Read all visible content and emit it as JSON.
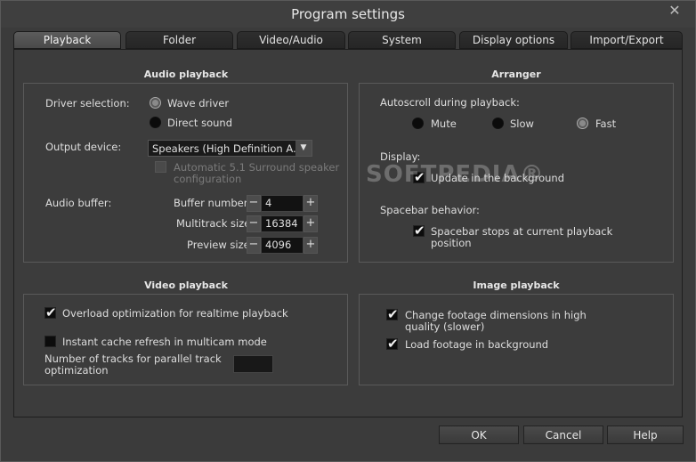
{
  "window": {
    "title": "Program settings",
    "close": "✕"
  },
  "tabs": [
    "Playback",
    "Folder",
    "Video/Audio",
    "System",
    "Display options",
    "Import/Export"
  ],
  "audio": {
    "title": "Audio playback",
    "driver_label": "Driver selection:",
    "driver_options": [
      "Wave driver",
      "Direct sound"
    ],
    "output_label": "Output device:",
    "output_value": "Speakers (High Definition A...",
    "surround_line1": "Automatic 5.1 Surround speaker",
    "surround_line2": "configuration",
    "buffer_label": "Audio buffer:",
    "buffer_number_label": "Buffer number:",
    "buffer_number": "4",
    "multitrack_label": "Multitrack size:",
    "multitrack": "16384",
    "preview_label": "Preview size:",
    "preview": "4096",
    "minus": "−",
    "plus": "+"
  },
  "arranger": {
    "title": "Arranger",
    "autoscroll_label": "Autoscroll during playback:",
    "autoscroll_options": [
      "Mute",
      "Slow",
      "Fast"
    ],
    "display_label": "Display:",
    "update_bg": "Update in the background",
    "spacebar_label": "Spacebar behavior:",
    "spacebar_line1": "Spacebar stops at current playback",
    "spacebar_line2": "position"
  },
  "video": {
    "title": "Video playback",
    "overload": "Overload optimization for realtime playback",
    "cache": "Instant cache refresh in multicam mode",
    "tracks_line1": "Number of tracks for parallel track",
    "tracks_line2": "optimization"
  },
  "image": {
    "title": "Image playback",
    "change_line1": "Change footage dimensions in high",
    "change_line2": "quality (slower)",
    "load_bg": "Load footage in background"
  },
  "buttons": {
    "ok": "OK",
    "cancel": "Cancel",
    "help": "Help"
  },
  "watermark": "SOFTPEDIA®"
}
